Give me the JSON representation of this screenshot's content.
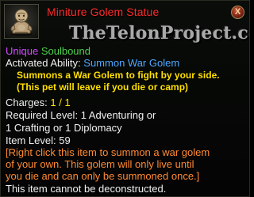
{
  "item": {
    "name": "Miniture Golem Statue",
    "icon": "golem-statue-icon",
    "close_label": "X",
    "watermark": "TheTelonProject.com"
  },
  "tags": {
    "unique": "Unique",
    "soulbound": "Soulbound"
  },
  "ability": {
    "label": "Activated Ability:",
    "name": "Summon War Golem",
    "desc_line1": "Summons a War Golem to fight by your side.",
    "desc_line2": "(This pet will leave if you die or camp)"
  },
  "stats": {
    "charges_label": "Charges:",
    "charges_value": "1 / 1",
    "required_level_label": "Required Level:",
    "required_level_line1": "1 Adventuring or",
    "required_level_line2": "1 Crafting or 1 Diplomacy",
    "item_level_label": "Item Level:",
    "item_level_value": "59"
  },
  "flavor": {
    "line1": "[Right click this item to summon a war golem",
    "line2": "of your own.   This golem will only live until",
    "line3": "you die and can only be summoned once.]"
  },
  "footer": {
    "note": "This item cannot be deconstructed."
  },
  "colors": {
    "title": "#ff2b2b",
    "unique": "#d24bff",
    "soulbound": "#4dd04d",
    "ability_name": "#4fa7ff",
    "charges": "#ffe300",
    "flavor": "#ff8a33"
  }
}
